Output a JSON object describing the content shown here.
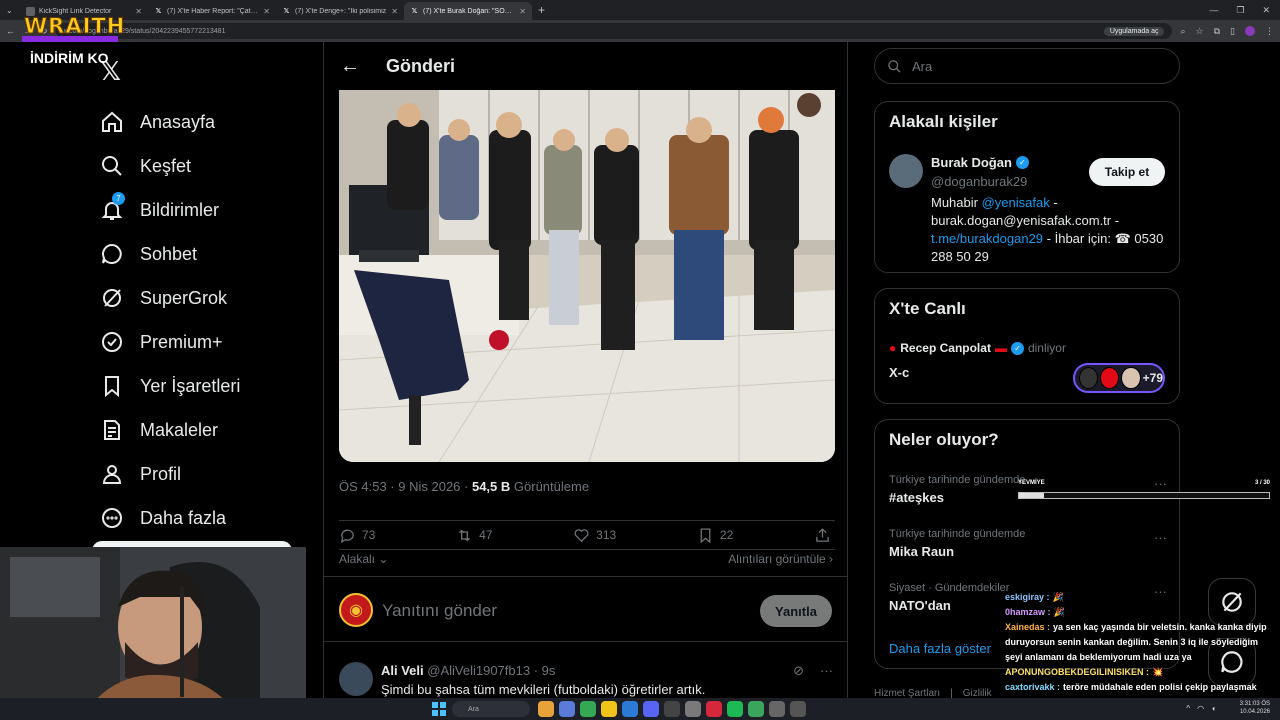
{
  "browser": {
    "tabs": [
      {
        "title": "KickSight Link Detector",
        "active": false
      },
      {
        "title": "(7) X'te Haber Report: \"Çatışma",
        "active": false
      },
      {
        "title": "(7) X'te Denge+: \"İki polisimiz",
        "active": false
      },
      {
        "title": "(7) X'te Burak Doğan: \"SON DA",
        "active": true
      }
    ],
    "url": "x.com/doganburak29/status/2042239455772213481",
    "app_chip": "Uygulamada aç"
  },
  "overlay": {
    "brand": "WRAITH",
    "promo": "İNDİRİM KO"
  },
  "nav": {
    "items": [
      {
        "label": "Anasayfa",
        "icon": "home-icon"
      },
      {
        "label": "Keşfet",
        "icon": "search-icon"
      },
      {
        "label": "Bildirimler",
        "icon": "bell-icon",
        "badge": "7"
      },
      {
        "label": "Sohbet",
        "icon": "chat-icon"
      },
      {
        "label": "SuperGrok",
        "icon": "grok-icon"
      },
      {
        "label": "Premium+",
        "icon": "verified-badge-icon"
      },
      {
        "label": "Yer İşaretleri",
        "icon": "bookmark-icon"
      },
      {
        "label": "Makaleler",
        "icon": "article-icon"
      },
      {
        "label": "Profil",
        "icon": "profile-icon"
      },
      {
        "label": "Daha fazla",
        "icon": "more-circle-icon"
      }
    ]
  },
  "post": {
    "header_title": "Gönderi",
    "time": "ÖS 4:53 · 9 Nis 2026 ·",
    "views_count": "54,5 B",
    "views_label": "Görüntüleme",
    "replies": "73",
    "reposts": "47",
    "likes": "313",
    "bookmarks": "22",
    "relevant_label": "Alakalı",
    "quotes_label": "Alıntıları görüntüle",
    "reply_placeholder": "Yanıtını gönder",
    "reply_button": "Yanıtla"
  },
  "comment": {
    "name": "Ali Veli",
    "handle": "@AliVeli1907fb13",
    "time": "· 9s",
    "text": "Şimdi bu şahsa tüm mevkileri (futboldaki) öğretirler artık."
  },
  "sidebar": {
    "search_placeholder": "Ara",
    "relevant_title": "Alakalı kişiler",
    "person": {
      "name": "Burak Doğan",
      "handle": "@doganburak29",
      "follow": "Takip et",
      "bio_1": "Muhabir",
      "bio_link1": "@yenisafak",
      "bio_2": "- burak.dogan@yenisafak.com.tr -",
      "bio_link2": "t.me/burakdogan29",
      "bio_3": "- İhbar için: ☎",
      "bio_4": "0530 288 50 29"
    },
    "live_title": "X'te Canlı",
    "live_host": "Recep Canpolat",
    "live_status": "dinliyor",
    "live_space": "X-c",
    "live_count": "+79",
    "trends_title": "Neler oluyor?",
    "trends": [
      {
        "category": "Türkiye tarihinde gündemde",
        "name": "#ateşkes"
      },
      {
        "category": "Türkiye tarihinde gündemde",
        "name": "Mika Raun"
      },
      {
        "category": "Siyaset · Gündemdekiler",
        "name": "NATO'dan"
      }
    ],
    "show_more": "Daha fazla göster",
    "footer": [
      "Hizmet Şartları",
      "Gizlilik"
    ]
  },
  "progress_overlay": {
    "label": "YEVMİYE",
    "count": "3 / 30",
    "fraction": 0.1
  },
  "chat": [
    {
      "user": "eskigiray :",
      "color": "#8ec5ff",
      "msg": "🎉"
    },
    {
      "user": "0hamzaw :",
      "color": "#d39bff",
      "msg": "🎉"
    },
    {
      "user": "Xainedas :",
      "color": "#ffb347",
      "msg": "ya sen kaç yaşında bir veletsin. kanka kanka diyip duruyorsun senin kankan değilim. Senin 3 iq ile söylediğim şeyi anlamanı da beklemiyorum hadi uza ya"
    },
    {
      "user": "APONUNGOBEKDEGILINISIKEN :",
      "color": "#ffe066",
      "msg": "💥"
    },
    {
      "user": "caxtorivakk :",
      "color": "#7fdcff",
      "msg": "teröre müdahale eden polisi çekip paylaşmak nasıl suç değil"
    }
  ],
  "taskbar": {
    "search": "Ara",
    "time": "3:31:03 ÖS",
    "date": "10.04.2026"
  }
}
